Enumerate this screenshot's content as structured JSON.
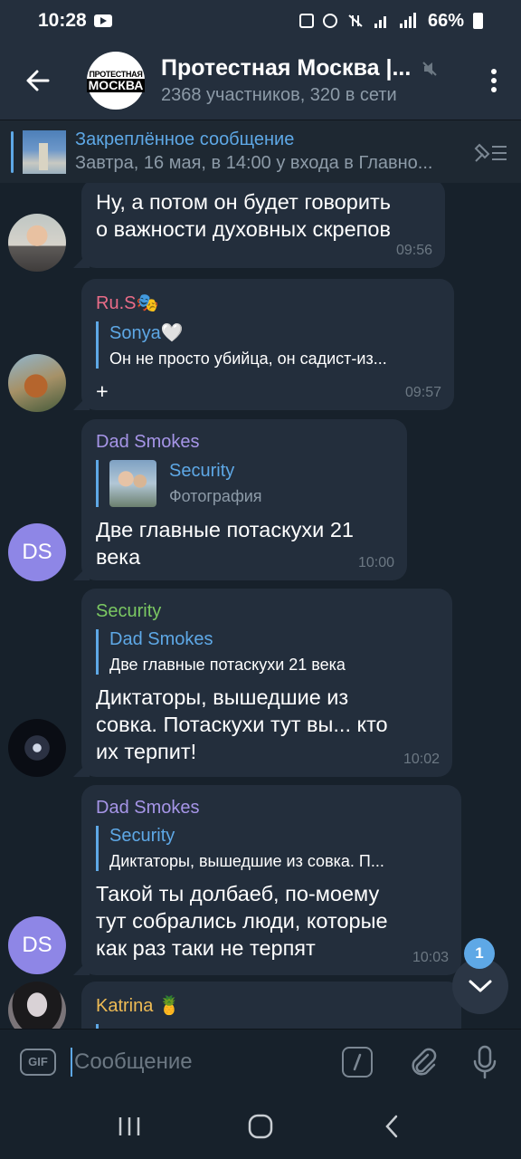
{
  "status_bar": {
    "time": "10:28",
    "battery": "66%"
  },
  "header": {
    "avatar_line1": "ПРОТЕСТНАЯ",
    "avatar_line2": "МОСКВА",
    "title": "Протестная Москва |...",
    "subtitle": "2368 участников, 320 в сети"
  },
  "pinned": {
    "label": "Закреплённое сообщение",
    "preview": "Завтра, 16 мая, в 14:00 у входа в Главно..."
  },
  "messages": [
    {
      "text_lines": [
        "Ну, а потом он будет говорить",
        "о важности духовных скрепов"
      ],
      "time": "09:56"
    },
    {
      "sender": "Ru.S🎭",
      "sender_color": "#e96c88",
      "reply_name": "Sonya🤍",
      "reply_text": "Он не просто убийца, он садист-из...",
      "text": "+",
      "time": "09:57"
    },
    {
      "sender": "Dad Smokes",
      "sender_color": "#a695e7",
      "avatar_initials": "DS",
      "reply_name": "Security",
      "reply_text": "Фотография",
      "text_lines": [
        "Две главные потаскухи 21",
        "века"
      ],
      "time": "10:00"
    },
    {
      "sender": "Security",
      "sender_color": "#7bc862",
      "reply_name": "Dad Smokes",
      "reply_text": "Две главные потаскухи 21 века",
      "text_lines": [
        "Диктаторы, вышедшие из",
        "совка.  Потаскухи тут вы... кто",
        "их терпит!"
      ],
      "time": "10:02"
    },
    {
      "sender": "Dad Smokes",
      "sender_color": "#a695e7",
      "avatar_initials": "DS",
      "reply_name": "Security",
      "reply_text": "Диктаторы, вышедшие из совка.  П...",
      "text_lines": [
        "Такой ты долбаеб, по-моему",
        "тут собрались люди, которые",
        "как раз таки не терпят"
      ],
      "time": "10:03"
    },
    {
      "sender": "Katrina 🍍",
      "sender_color": "#eebb55"
    }
  ],
  "unread_count": "1",
  "composer": {
    "gif_label": "GIF",
    "placeholder": "Сообщение"
  },
  "colors": {
    "accent": "#5ea8e6",
    "background": "#17212b",
    "bubble": "#232e3c",
    "header": "#242f3d"
  }
}
